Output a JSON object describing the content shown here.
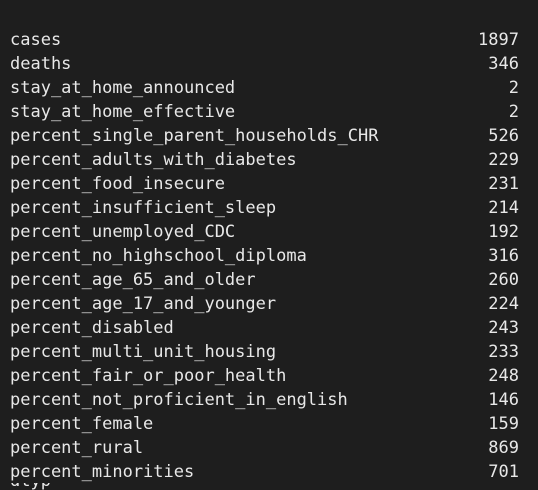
{
  "output": {
    "rows": [
      {
        "label": "cases",
        "value": "1897"
      },
      {
        "label": "deaths",
        "value": "346"
      },
      {
        "label": "stay_at_home_announced",
        "value": "2"
      },
      {
        "label": "stay_at_home_effective",
        "value": "2"
      },
      {
        "label": "percent_single_parent_households_CHR",
        "value": "526"
      },
      {
        "label": "percent_adults_with_diabetes",
        "value": "229"
      },
      {
        "label": "percent_food_insecure",
        "value": "231"
      },
      {
        "label": "percent_insufficient_sleep",
        "value": "214"
      },
      {
        "label": "percent_unemployed_CDC",
        "value": "192"
      },
      {
        "label": "percent_no_highschool_diploma",
        "value": "316"
      },
      {
        "label": "percent_age_65_and_older",
        "value": "260"
      },
      {
        "label": "percent_age_17_and_younger",
        "value": "224"
      },
      {
        "label": "percent_disabled",
        "value": "243"
      },
      {
        "label": "percent_multi_unit_housing",
        "value": "233"
      },
      {
        "label": "percent_fair_or_poor_health",
        "value": "248"
      },
      {
        "label": "percent_not_proficient_in_english",
        "value": "146"
      },
      {
        "label": "percent_female",
        "value": "159"
      },
      {
        "label": "percent_rural",
        "value": "869"
      },
      {
        "label": "percent_minorities",
        "value": "701"
      }
    ],
    "cut_off_row_fragment": "dtyp"
  }
}
